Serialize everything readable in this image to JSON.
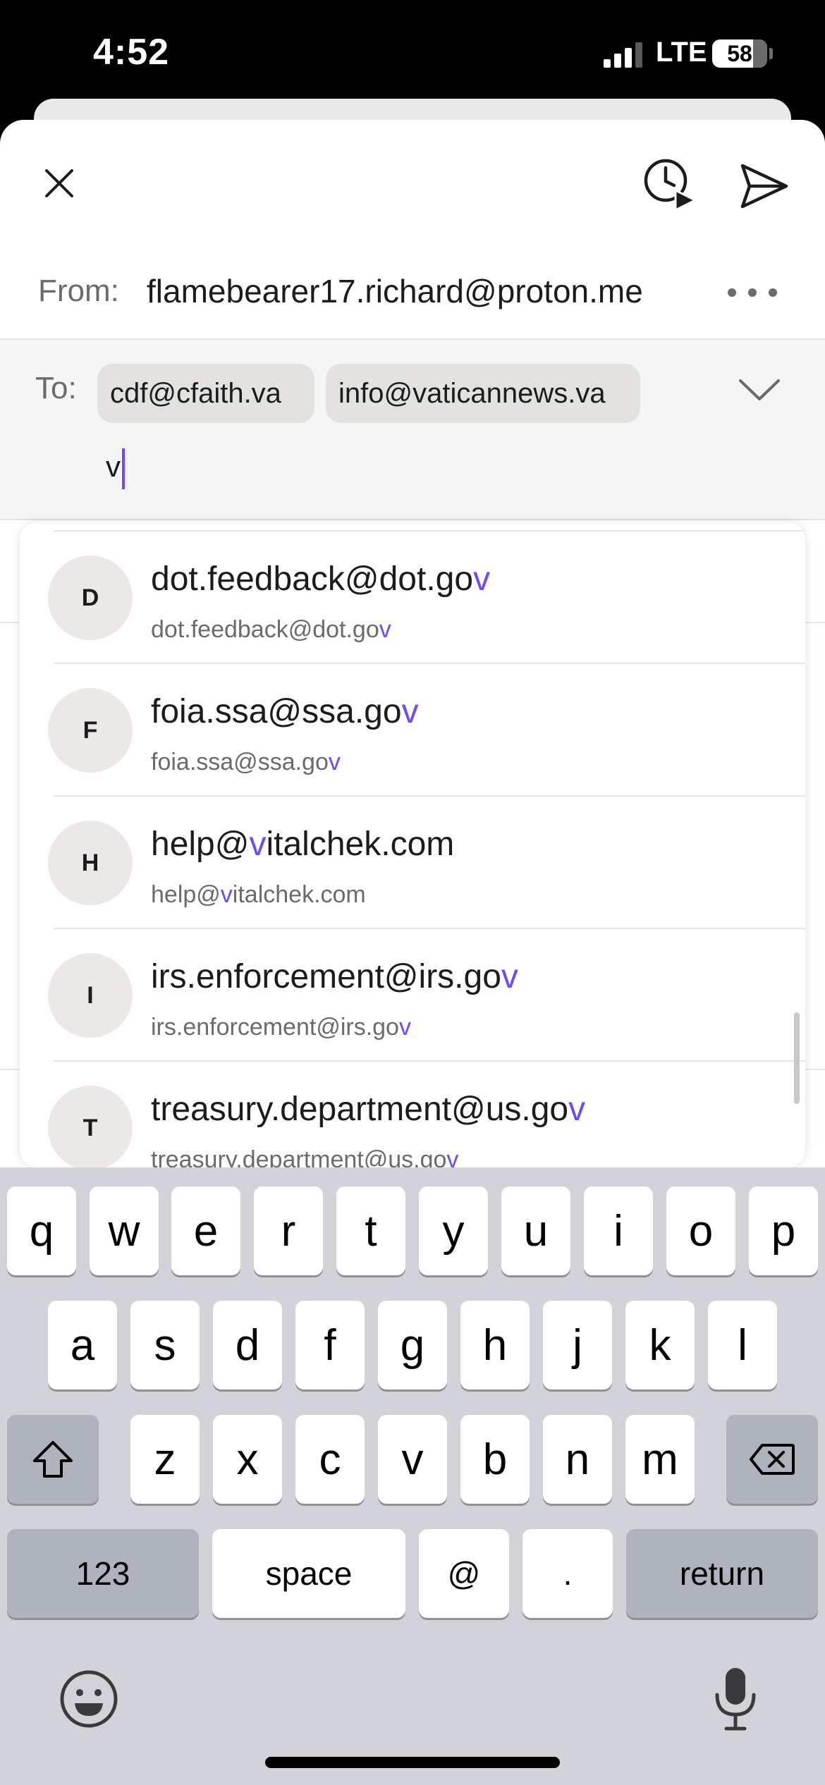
{
  "status_bar": {
    "time": "4:52",
    "network": "LTE",
    "battery": "58"
  },
  "compose": {
    "from_label": "From:",
    "from_address": "flamebearer17.richard@proton.me",
    "to_label": "To:",
    "recipients": [
      "cdf@cfaith.va",
      "info@vaticannews.va"
    ],
    "typed_text": "v"
  },
  "suggestions": [
    {
      "initial": "D",
      "name_pre": "dot.feedback@dot.go",
      "name_hl": "v",
      "name_post": "",
      "email_pre": "dot.feedback@dot.go",
      "email_hl": "v",
      "email_post": ""
    },
    {
      "initial": "F",
      "name_pre": "foia.ssa@ssa.go",
      "name_hl": "v",
      "name_post": "",
      "email_pre": "foia.ssa@ssa.go",
      "email_hl": "v",
      "email_post": ""
    },
    {
      "initial": "H",
      "name_pre": "help@",
      "name_hl": "v",
      "name_post": "italchek.com",
      "email_pre": "help@",
      "email_hl": "v",
      "email_post": "italchek.com"
    },
    {
      "initial": "I",
      "name_pre": "irs.enforcement@irs.go",
      "name_hl": "v",
      "name_post": "",
      "email_pre": "irs.enforcement@irs.go",
      "email_hl": "v",
      "email_post": ""
    },
    {
      "initial": "T",
      "name_pre": "treasury.department@us.go",
      "name_hl": "v",
      "name_post": "",
      "email_pre": "treasury.department@us.go",
      "email_hl": "v",
      "email_post": ""
    }
  ],
  "keyboard": {
    "row1": [
      "q",
      "w",
      "e",
      "r",
      "t",
      "y",
      "u",
      "i",
      "o",
      "p"
    ],
    "row2": [
      "a",
      "s",
      "d",
      "f",
      "g",
      "h",
      "j",
      "k",
      "l"
    ],
    "row3": [
      "z",
      "x",
      "c",
      "v",
      "b",
      "n",
      "m"
    ],
    "numbers_label": "123",
    "space_label": "space",
    "at_label": "@",
    "dot_label": ".",
    "return_label": "return"
  },
  "colors": {
    "accent": "#6d4aff",
    "keyboard_bg": "#d1d3d9"
  }
}
